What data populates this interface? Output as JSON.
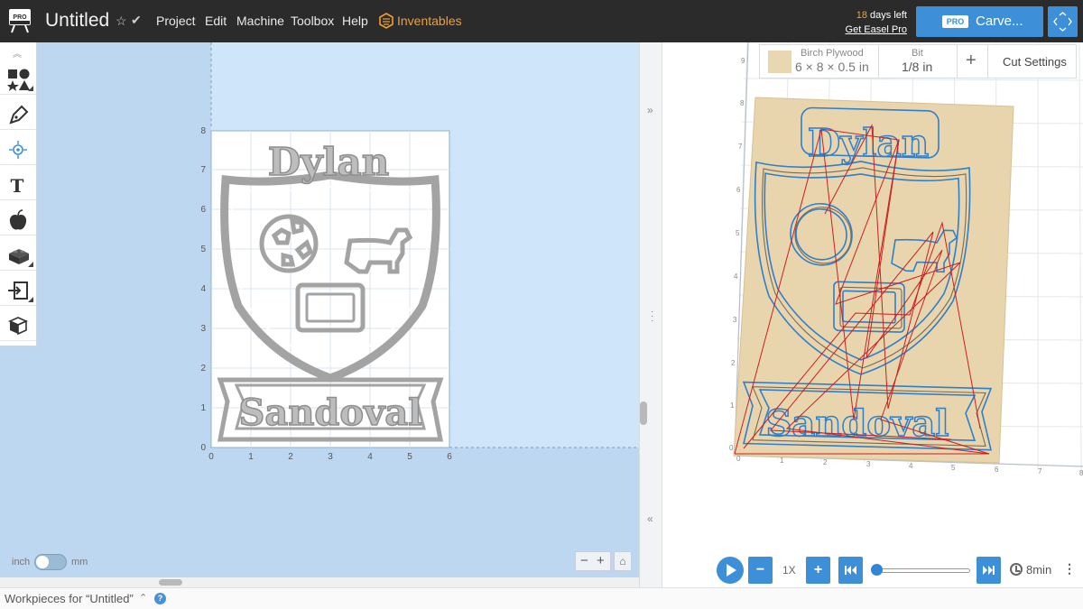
{
  "app": {
    "title": "Untitled",
    "logo_text": "PRO",
    "menu": [
      "Project",
      "Edit",
      "Machine",
      "Toolbox",
      "Help"
    ],
    "inventables_label": "Inventables",
    "trial_days": "18",
    "trial_suffix": " days left",
    "trial_link": "Get Easel Pro",
    "carve_badge": "PRO",
    "carve_label": "Carve...",
    "accent_color": "#3d8fd8",
    "highlight_color": "#f0a030"
  },
  "tools": [
    {
      "name": "shapes-icon",
      "has_submenu": true
    },
    {
      "name": "pen-icon",
      "has_submenu": false
    },
    {
      "name": "point-icon",
      "has_submenu": false
    },
    {
      "name": "text-icon",
      "has_submenu": false
    },
    {
      "name": "apple-icon",
      "has_submenu": false
    },
    {
      "name": "lego-brick-icon",
      "has_submenu": true
    },
    {
      "name": "import-icon",
      "has_submenu": true
    },
    {
      "name": "cube-icon",
      "has_submenu": false
    }
  ],
  "design": {
    "x_ticks": [
      "0",
      "1",
      "2",
      "3",
      "4",
      "5",
      "6"
    ],
    "y_ticks": [
      "0",
      "1",
      "2",
      "3",
      "4",
      "5",
      "6",
      "7",
      "8"
    ],
    "top_text": "Dylan",
    "bottom_text": "Sandoval",
    "unit_left": "inch",
    "unit_right": "mm",
    "zoom_minus": "−",
    "zoom_plus": "+"
  },
  "preview": {
    "material_name": "Birch Plywood",
    "material_dims": "6 × 8 × 0.5 in",
    "bit_label": "Bit",
    "bit_value": "1/8 in",
    "add_label": "+",
    "cut_settings_label": "Cut Settings",
    "x_ticks": [
      "0",
      "1",
      "2",
      "3",
      "4",
      "5",
      "6",
      "7",
      "8"
    ],
    "y_ticks": [
      "0",
      "1",
      "2",
      "3",
      "4",
      "5",
      "6",
      "7",
      "8",
      "9"
    ],
    "top_text": "Dylan",
    "bottom_text": "Sandoval",
    "wood_color": "#e8d5ae",
    "path_outline_color": "#2f7fc9",
    "rapid_move_color": "#cc1f1f"
  },
  "simulation": {
    "speed": "1X",
    "minus_label": "−",
    "plus_label": "+",
    "progress": 0,
    "time": "8min"
  },
  "status": {
    "workpieces_label": "Workpieces for “Untitled”",
    "help_label": "?"
  }
}
